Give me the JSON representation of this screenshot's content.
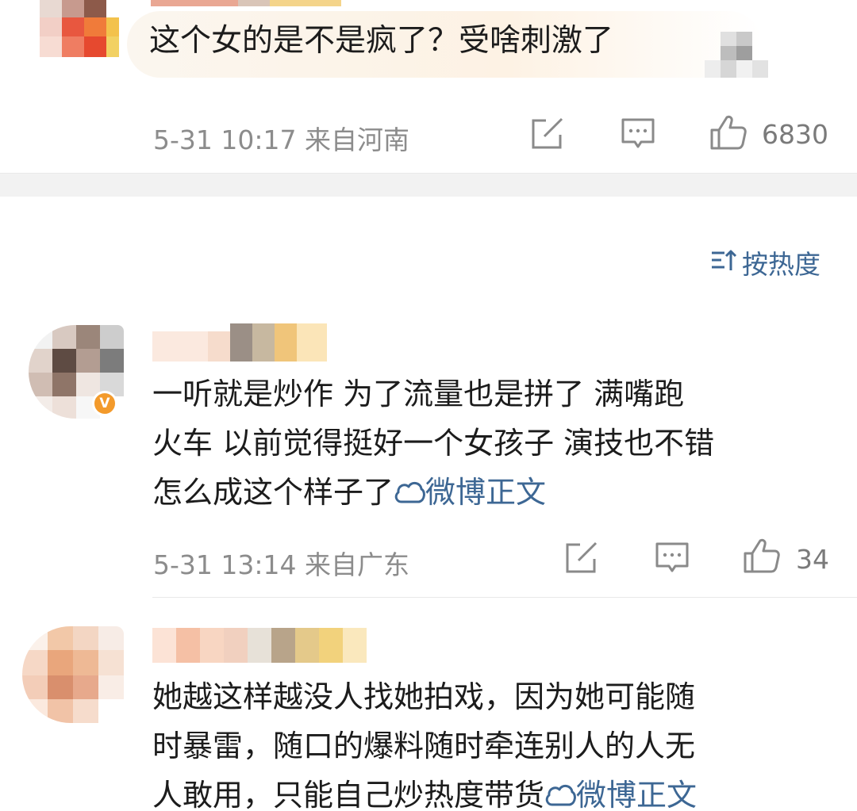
{
  "comments": [
    {
      "text": "这个女的是不是疯了？受啥刺激了",
      "time": "5-31 10:17",
      "location": "来自河南",
      "likes": "6830"
    },
    {
      "text_line1": "一听就是炒作  为了流量也是拼了 满嘴跑",
      "text_line2": "火车 以前觉得挺好一个女孩子 演技也不错",
      "text_line3": "怎么成这个样子了",
      "link": "微博正文",
      "time": "5-31 13:14",
      "location": "来自广东",
      "likes": "34"
    },
    {
      "text_line1": "她越这样越没人找她拍戏，因为她可能随",
      "text_line2": "时暴雷，随口的爆料随时牵连别人的人无",
      "text_line3": "人敢用，只能自己炒热度带货",
      "link": "微博正文"
    }
  ],
  "sort": {
    "label": "按热度"
  },
  "badges": {
    "verified": "V"
  },
  "icons": [
    "share-icon",
    "comment-icon",
    "like-icon",
    "sort-icon",
    "weibo-link-icon",
    "verified-badge-icon"
  ],
  "colors": {
    "link": "#3d6794",
    "meta": "#8c8c8c",
    "badge": "#f39a2b",
    "divider": "#f2f2f2"
  }
}
